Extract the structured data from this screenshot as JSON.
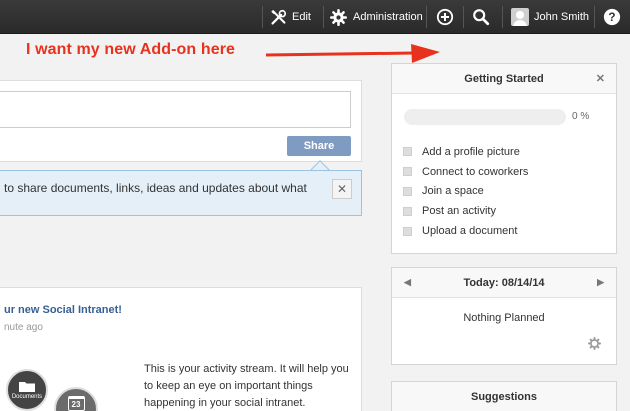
{
  "topbar": {
    "edit_label": "Edit",
    "administration_label": "Administration",
    "user_name": "John Smith",
    "icons": [
      "tools-icon",
      "gear-icon",
      "add-circle-icon",
      "search-icon",
      "avatar",
      "help-icon"
    ]
  },
  "annotation": {
    "text": "I want my new Add-on here",
    "color": "#e8321e"
  },
  "composer": {
    "share_label": "Share",
    "info_text": "to share documents, links, ideas and updates about what",
    "close_glyph": "✕"
  },
  "stream": {
    "title": "ur new Social Intranet!",
    "time": "nute ago",
    "body": "This is your activity stream. It will help you to keep an eye on important things happening in your social intranet.",
    "documents_label": "Documents",
    "calendar_day": "23"
  },
  "getting_started": {
    "title": "Getting Started",
    "close_glyph": "✕",
    "progress_percent": 0,
    "progress_label": "0 %",
    "items": [
      {
        "label": "Add a profile picture"
      },
      {
        "label": "Connect to coworkers"
      },
      {
        "label": "Join a space"
      },
      {
        "label": "Post an activity"
      },
      {
        "label": "Upload a document"
      }
    ]
  },
  "calendar": {
    "title": "Today: 08/14/14",
    "prev_glyph": "◀",
    "next_glyph": "▶",
    "empty_text": "Nothing Planned"
  },
  "suggestions": {
    "title": "Suggestions"
  },
  "colors": {
    "accent": "#7f9bc1",
    "link": "#375f94",
    "info_bg": "#e4eff8"
  }
}
